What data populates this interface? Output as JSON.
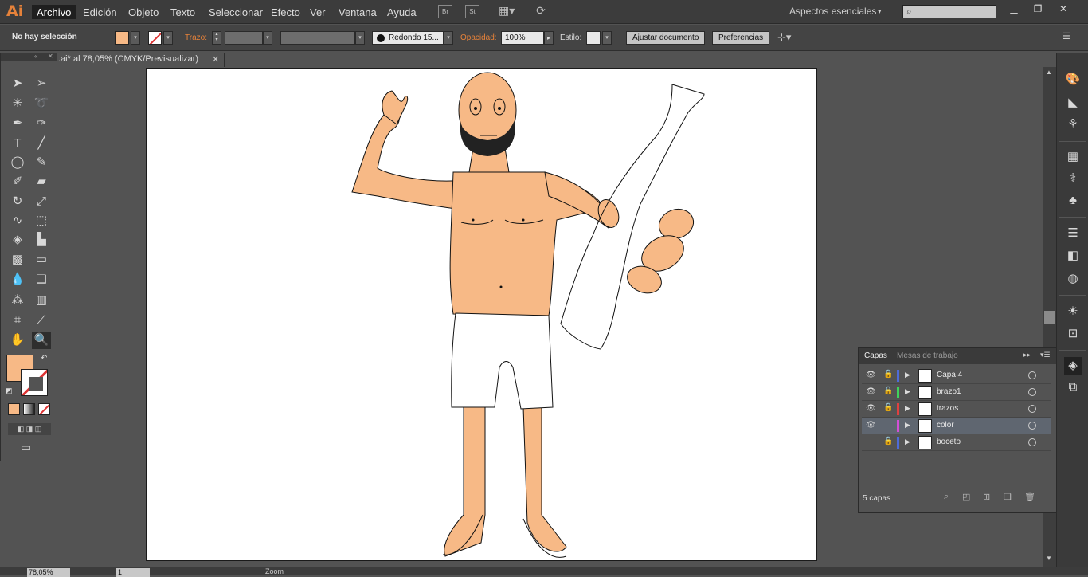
{
  "app": {
    "logo": "Ai"
  },
  "menu": {
    "items": [
      "Archivo",
      "Edición",
      "Objeto",
      "Texto",
      "Seleccionar",
      "Efecto",
      "Ver",
      "Ventana",
      "Ayuda"
    ],
    "bridge_icon": "Br",
    "stock_icon": "St",
    "workspace": "Aspectos esenciales"
  },
  "control_bar": {
    "selection_status": "No hay selección",
    "stroke_label": "Trazo:",
    "brush": "Redondo 15...",
    "opacity_label": "Opacidad:",
    "opacity_value": "100%",
    "style_label": "Estilo:",
    "adjust_document": "Ajustar documento",
    "preferences": "Preferencias",
    "fill_color": "#f7b986"
  },
  "document": {
    "tab_title": ".ai* al 78,05% (CMYK/Previsualizar)"
  },
  "status_bar": {
    "zoom": "78,05%",
    "artboard": "1",
    "tool": "Zoom"
  },
  "layers_panel": {
    "tabs": [
      "Capas",
      "Mesas de trabajo"
    ],
    "layers": [
      {
        "name": "Capa 4",
        "color": "#4e6bd8",
        "visible": true,
        "locked": true
      },
      {
        "name": "brazo1",
        "color": "#3fd35a",
        "visible": true,
        "locked": true
      },
      {
        "name": "trazos",
        "color": "#e04040",
        "visible": true,
        "locked": true
      },
      {
        "name": "color",
        "color": "#d34fd6",
        "visible": true,
        "locked": false
      },
      {
        "name": "boceto",
        "color": "#4e6bd8",
        "visible": false,
        "locked": true
      }
    ],
    "count": "5 capas"
  }
}
